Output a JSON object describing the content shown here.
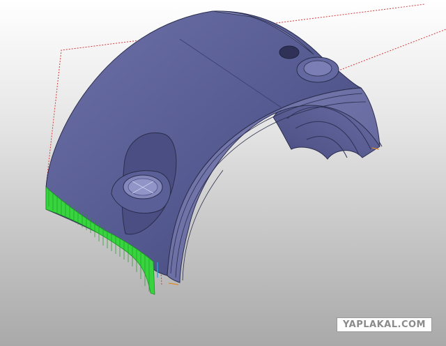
{
  "viewport": {
    "background_top": "#ffffff",
    "background_bottom": "#a9a9a9",
    "model_body_color": "#565b92",
    "model_edge_color": "#2a2d4c",
    "selected_face_color": "#37d43e",
    "construction_line_color": "#d43a3a"
  },
  "watermark": {
    "text": "YAPLAKAL.COM"
  }
}
